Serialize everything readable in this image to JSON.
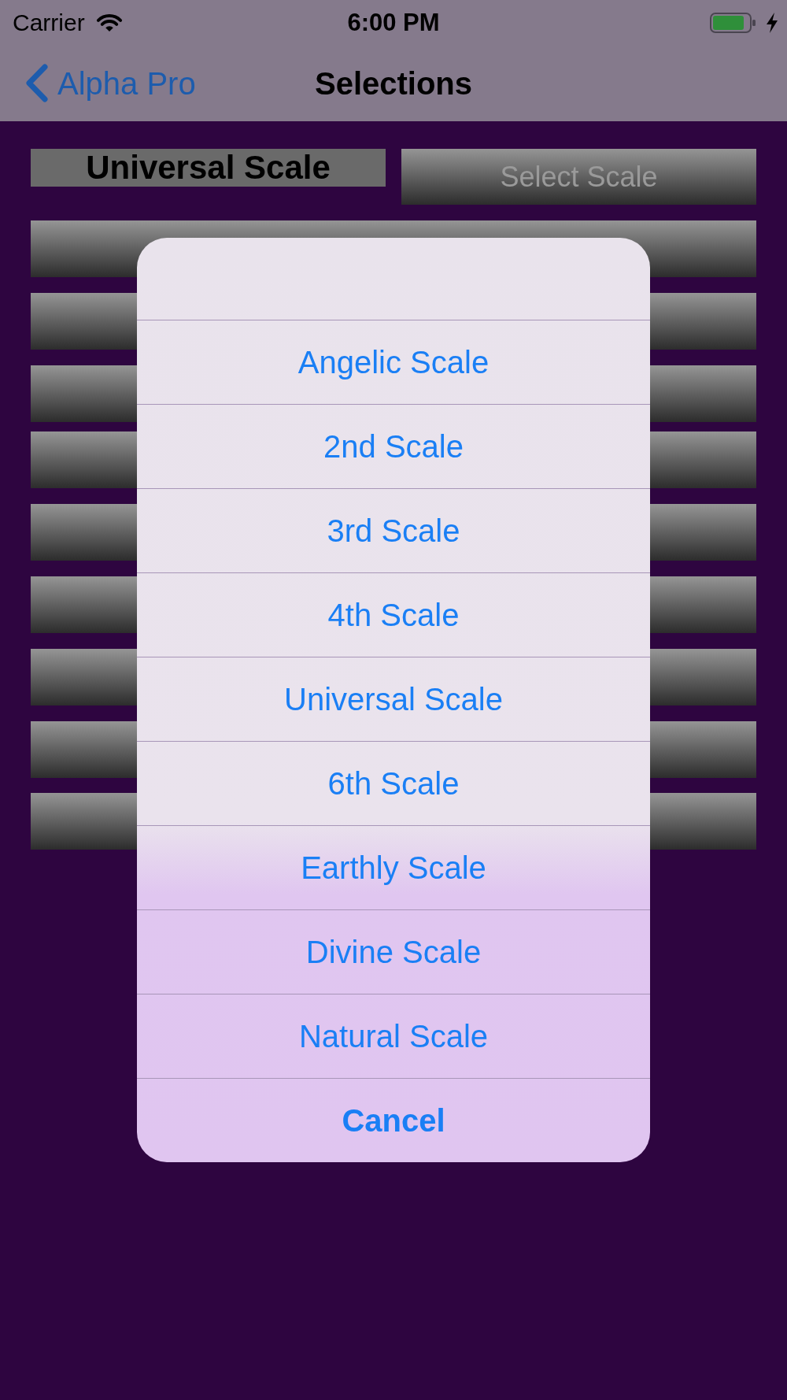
{
  "status_bar": {
    "carrier": "Carrier",
    "time": "6:00 PM"
  },
  "nav_bar": {
    "back_label": "Alpha Pro",
    "title": "Selections"
  },
  "current_scale": "Universal Scale",
  "select_button": "Select Scale",
  "action_sheet": {
    "options": [
      "Angelic Scale",
      "2nd Scale",
      "3rd Scale",
      "4th Scale",
      "Universal Scale",
      "6th Scale",
      "Earthly Scale",
      "Divine Scale",
      "Natural Scale"
    ],
    "cancel": "Cancel"
  }
}
